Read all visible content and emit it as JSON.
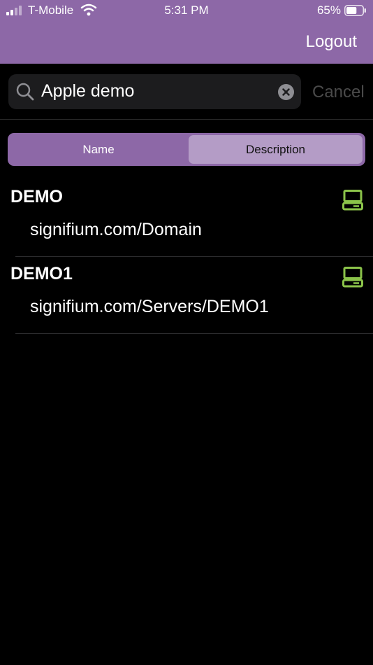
{
  "status_bar": {
    "carrier": "T-Mobile",
    "time": "5:31 PM",
    "battery_percent": "65%",
    "battery_level": 0.65,
    "icons": [
      "signal-icon",
      "wifi-icon",
      "battery-icon"
    ]
  },
  "nav": {
    "logout_label": "Logout"
  },
  "search": {
    "value": "Apple demo",
    "cancel_label": "Cancel",
    "icons": [
      "search-icon",
      "clear-icon"
    ]
  },
  "segments": {
    "items": [
      "Name",
      "Description"
    ],
    "selected": "Description"
  },
  "results": [
    {
      "title": "DEMO",
      "subtitle": "signifium.com/Domain",
      "icon": "computer-icon"
    },
    {
      "title": "DEMO1",
      "subtitle": "signifium.com/Servers/DEMO1",
      "icon": "computer-icon"
    }
  ],
  "colors": {
    "header": "#8d68a7",
    "segment_selected": "#b49cc6",
    "icon_green": "#8bc34a",
    "cancel_text": "#4a4a4a",
    "background": "#000000"
  }
}
